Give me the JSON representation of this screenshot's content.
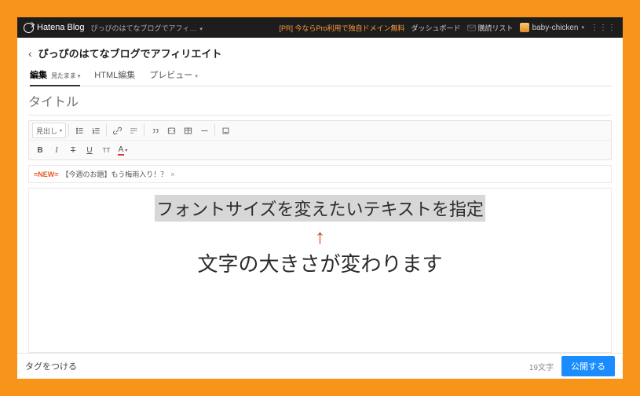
{
  "topbar": {
    "logo": "Hatena Blog",
    "blog_selector": "ぴっぴのはてなブログでアフィ…",
    "pr_text": "[PR] 今ならPro利用で独自ドメイン無料",
    "dashboard": "ダッシュボード",
    "deliver_list": "購読リスト",
    "username": "baby-chicken"
  },
  "breadcrumb": {
    "back": "‹",
    "title": "ぴっぴのはてなブログでアフィリエイト"
  },
  "tabs": {
    "edit": "編集",
    "edit_sub": "見たまま",
    "html": "HTML編集",
    "preview": "プレビュー"
  },
  "title_placeholder": "タイトル",
  "toolbar": {
    "heading_sel": "見出し",
    "bold": "B",
    "italic": "I",
    "strike": "T",
    "underline": "U",
    "tt": "T T",
    "color": "A"
  },
  "banner": {
    "new": "=NEW=",
    "text": "【今週のお題】もう梅雨入り！？",
    "close": "×"
  },
  "editor": {
    "highlighted": "フォントサイズを変えたいテキストを指定",
    "arrow": "↑",
    "caption": "文字の大きさが変わります"
  },
  "footer": {
    "tag_add": "タグをつける",
    "char_count": "19文字",
    "publish": "公開する"
  }
}
